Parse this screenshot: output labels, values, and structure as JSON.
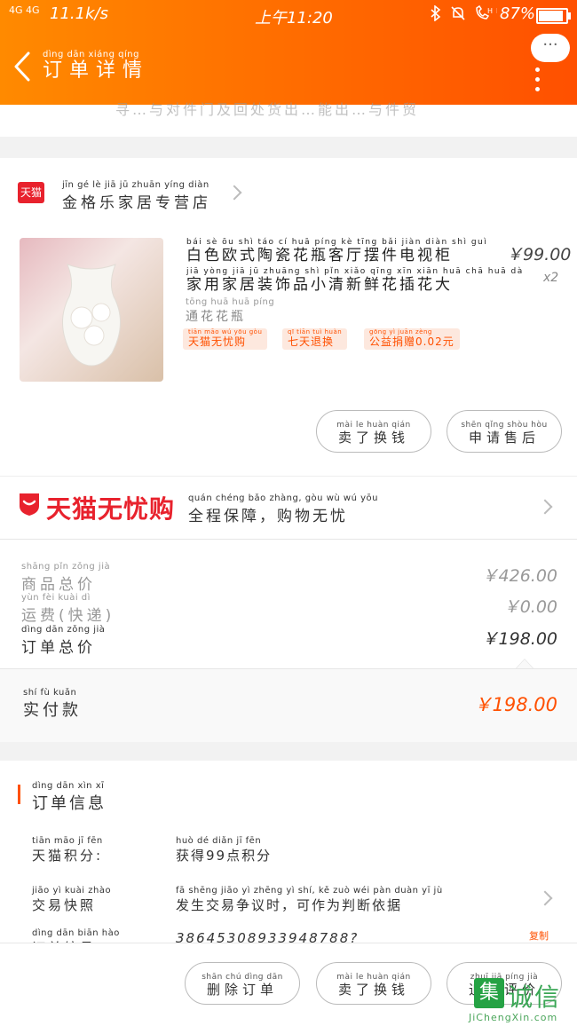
{
  "status_bar": {
    "signal": "4G 4G",
    "speed": "11.1k/s",
    "time": "上午11:20",
    "icons": "bluetooth-icon mute-icon hd-call-icon",
    "battery": "87%"
  },
  "header": {
    "title_pinyin": "dìng dān xiáng qíng",
    "title": "订单详情",
    "more_label": "···"
  },
  "top_snippet": "寻…与对件门及回处货出…能出…与件贸",
  "shop": {
    "badge": "天猫",
    "name_pinyin": "jīn gé lè jiā jū zhuān yíng diàn",
    "name": "金格乐家居专营店"
  },
  "product": {
    "title_pinyin_1": "bái sè ōu shì táo cí huā píng kè tīng bǎi jiàn diàn shì guì",
    "title_line_1": "白色欧式陶瓷花瓶客厅摆件电视柜",
    "title_pinyin_2": "jiā yòng jiā jū zhuāng shì pǐn xiǎo qīng xīn xiān huā chā huā dà",
    "title_line_2": "家用家居装饰品小清新鲜花插花大",
    "variant_pinyin": "tōng huā huā píng",
    "variant": "通花花瓶",
    "price": "￥99.00",
    "qty": "x2",
    "tags": [
      {
        "pinyin": "tiān māo wú yōu gòu",
        "text": "天猫无忧购"
      },
      {
        "pinyin": "qī tiān tuì huàn",
        "text": "七天退换"
      },
      {
        "pinyin": "gōng yì juān zèng",
        "text": "公益捐赠0.02元"
      }
    ],
    "buttons": [
      {
        "pinyin": "mài le huàn qián",
        "text": "卖了换钱"
      },
      {
        "pinyin": "shēn qǐng shòu hòu",
        "text": "申请售后"
      }
    ]
  },
  "guarantee": {
    "brand": "天猫无忧购",
    "pinyin": "quán chéng bǎo zhàng, gòu wù wú yōu",
    "text": "全程保障，购物无忧"
  },
  "summary": {
    "goods_total": {
      "pinyin": "shāng pǐn zǒng jià",
      "label": "商品总价",
      "value": "￥426.00"
    },
    "shipping": {
      "pinyin": "yùn fèi  kuài dì",
      "label": "运费(快递)",
      "value": "￥0.00"
    },
    "order_total": {
      "pinyin": "dìng dān zǒng jià",
      "label": "订单总价",
      "value": "￥198.00"
    },
    "paid": {
      "pinyin": "shí fù kuǎn",
      "label": "实付款",
      "value": "￥198.00"
    }
  },
  "order_info": {
    "section_pinyin": "dìng dān xìn xī",
    "section_title": "订单信息",
    "rows": [
      {
        "label_pinyin": "tiān māo jī fēn",
        "label": "天猫积分:",
        "value_pinyin": "huò dé  diǎn jī fēn",
        "value": "获得99点积分"
      },
      {
        "label_pinyin": "jiāo yì kuài zhào",
        "label": "交易快照",
        "value_pinyin": "fā shēng jiāo yì zhēng yì shí, kě zuò wéi pàn duàn yī jù",
        "value": "发生交易争议时，可作为判断依据"
      },
      {
        "label_pinyin": "dìng dān biān hào",
        "label": "订单编号:",
        "value": "38645308933948788?",
        "action": "复制"
      }
    ]
  },
  "bottom_bar": {
    "buttons": [
      {
        "pinyin": "shān chú dìng dān",
        "text": "删除订单"
      },
      {
        "pinyin": "mài le huàn qián",
        "text": "卖了换钱"
      },
      {
        "pinyin": "zhuī jiā píng jià",
        "text": "追加评价"
      }
    ]
  },
  "watermark": {
    "logo": "集",
    "text": "诚信",
    "url": "JiChengXin.com"
  },
  "colors": {
    "accent": "#ff5000",
    "header_start": "#ff8a00",
    "tmall_red": "#e8222d"
  }
}
